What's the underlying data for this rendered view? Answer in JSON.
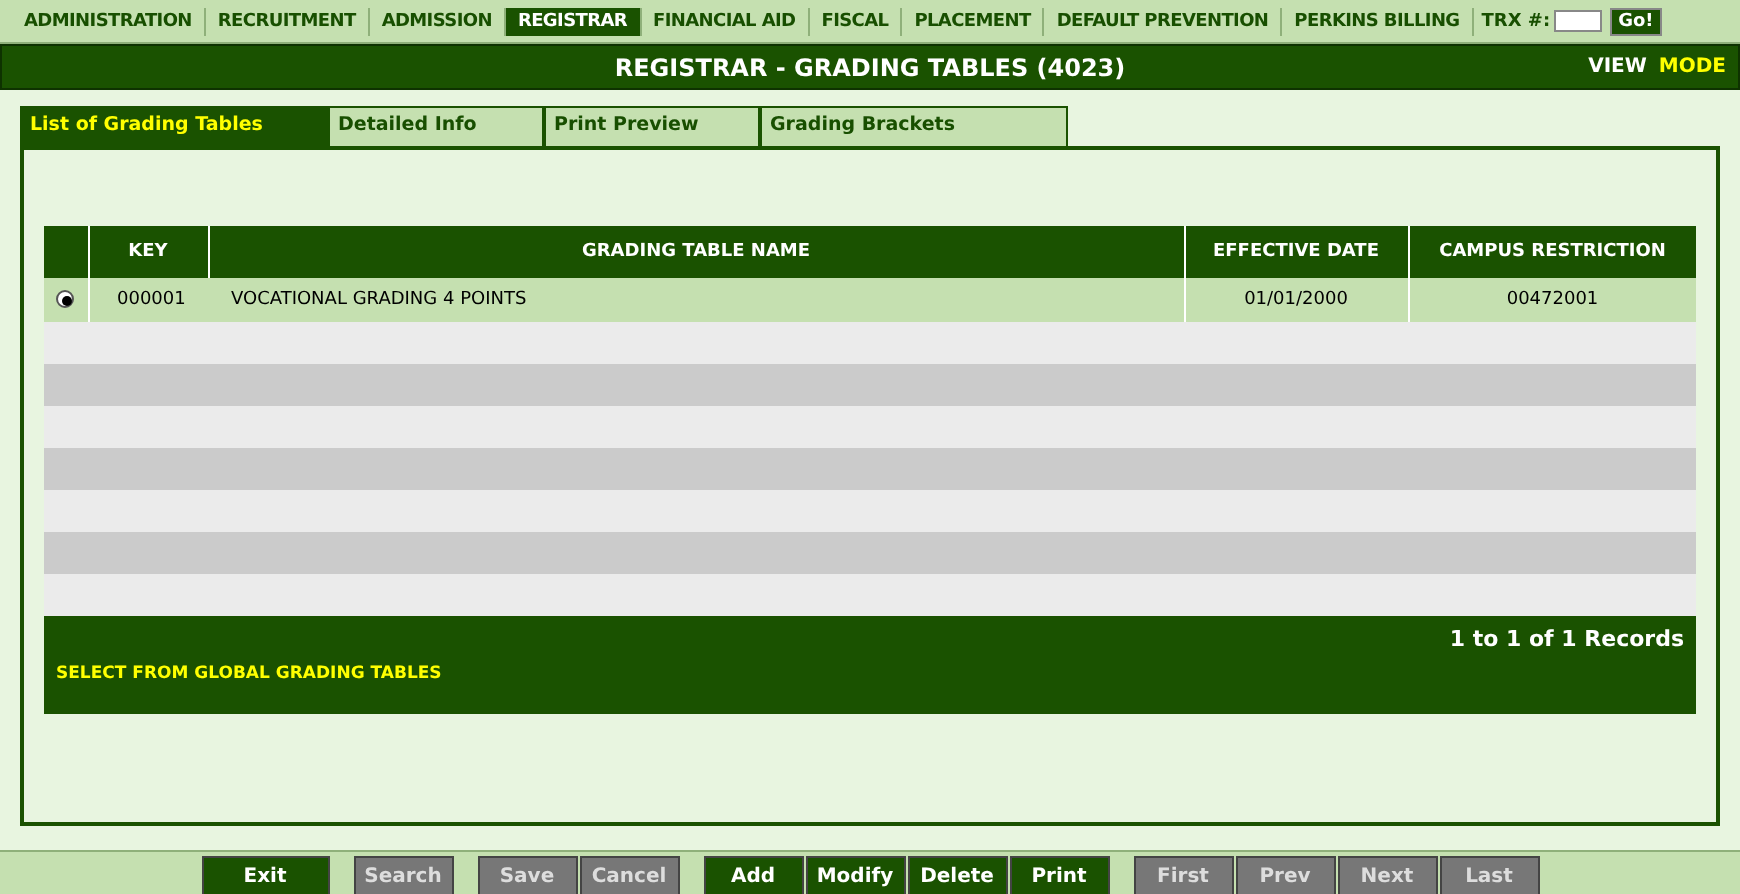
{
  "nav": {
    "items": [
      {
        "label": "ADMINISTRATION",
        "selected": false
      },
      {
        "label": "RECRUITMENT",
        "selected": false
      },
      {
        "label": "ADMISSION",
        "selected": false
      },
      {
        "label": "REGISTRAR",
        "selected": true
      },
      {
        "label": "FINANCIAL AID",
        "selected": false
      },
      {
        "label": "FISCAL",
        "selected": false
      },
      {
        "label": "PLACEMENT",
        "selected": false
      },
      {
        "label": "DEFAULT PREVENTION",
        "selected": false
      },
      {
        "label": "PERKINS BILLING",
        "selected": false
      }
    ],
    "trx_label": "TRX #:",
    "go_button": "Go!"
  },
  "title_bar": {
    "title": "REGISTRAR - GRADING TABLES (4023)",
    "view": "VIEW",
    "mode": "MODE"
  },
  "tabs": [
    {
      "label": "List of Grading Tables",
      "selected": true
    },
    {
      "label": "Detailed Info",
      "selected": false
    },
    {
      "label": "Print Preview",
      "selected": false
    },
    {
      "label": "Grading Brackets",
      "selected": false
    }
  ],
  "table": {
    "columns": [
      "KEY",
      "GRADING TABLE NAME",
      "EFFECTIVE DATE",
      "CAMPUS RESTRICTION"
    ],
    "rows": [
      {
        "selected": true,
        "key": "000001",
        "name": "VOCATIONAL GRADING 4 POINTS",
        "effective_date": "01/01/2000",
        "campus_restriction": "00472001"
      }
    ]
  },
  "footer": {
    "records": "1 to 1 of 1 Records",
    "link": "SELECT FROM GLOBAL GRADING TABLES"
  },
  "buttons": [
    [
      {
        "label": "Exit",
        "disabled": false
      }
    ],
    [
      {
        "label": "Search",
        "disabled": true
      }
    ],
    [
      {
        "label": "Save",
        "disabled": true
      },
      {
        "label": "Cancel",
        "disabled": true
      }
    ],
    [
      {
        "label": "Add",
        "disabled": false
      },
      {
        "label": "Modify",
        "disabled": false
      },
      {
        "label": "Delete",
        "disabled": false
      },
      {
        "label": "Print",
        "disabled": false
      }
    ],
    [
      {
        "label": "First",
        "disabled": true
      },
      {
        "label": "Prev",
        "disabled": true
      },
      {
        "label": "Next",
        "disabled": true
      },
      {
        "label": "Last",
        "disabled": true
      }
    ]
  ]
}
